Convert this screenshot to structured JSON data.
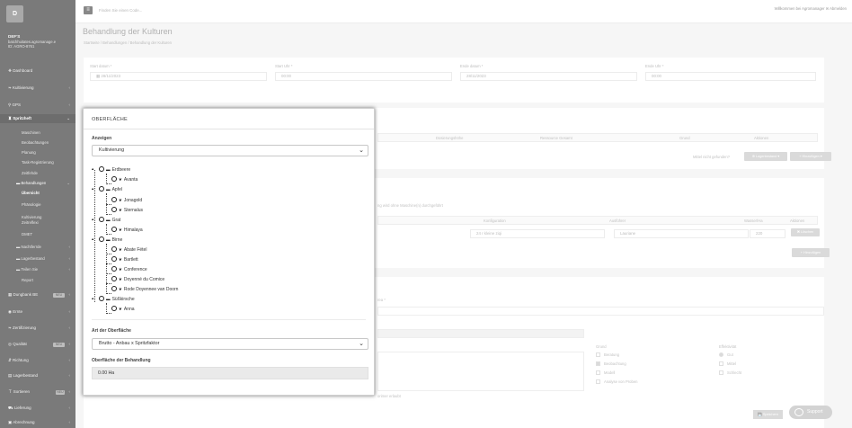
{
  "sidebar": {
    "logo": "D",
    "farm_name": "DEF'S",
    "farm_user": "batchhuitates.agromanage.e",
    "farm_id": "ID: AGRO-8761",
    "items": [
      {
        "label": "Dashboard"
      },
      {
        "label": "Kultivierung"
      },
      {
        "label": "GPS"
      },
      {
        "label": "Spritzheft"
      },
      {
        "label": "Maschinen"
      },
      {
        "label": "Beobachtungen"
      },
      {
        "label": "Planung"
      },
      {
        "label": "Task-Registrierung"
      },
      {
        "label": "Zeitfehde"
      },
      {
        "label": "Behandlungen"
      },
      {
        "label": "Übersicht"
      },
      {
        "label": "Phänologie"
      },
      {
        "label": "Kultivierung Zeitreflexi"
      },
      {
        "label": "DMET"
      },
      {
        "label": "Nachtferrde"
      },
      {
        "label": "Lagerbestand"
      },
      {
        "label": "Teilen Sie"
      },
      {
        "label": "Report"
      },
      {
        "label": "Dungbank BE"
      },
      {
        "label": "Ernte"
      },
      {
        "label": "Zertifizierung"
      },
      {
        "label": "Qualität"
      },
      {
        "label": "Richtung"
      },
      {
        "label": "Lagerbestand"
      },
      {
        "label": "Sortieren"
      },
      {
        "label": "Lieferung"
      },
      {
        "label": "Abrechnung"
      }
    ]
  },
  "topbar": {
    "search_placeholder": "Finden Sie einen Code...",
    "user": "Willkommen bei Agromanager  ✉ Abmelden"
  },
  "page": {
    "title": "Behandlung der Kulturen",
    "breadcrumb": "Startseite  /  Behandlungen  /  Behandlung der Kulturen"
  },
  "dates": {
    "start_date_label": "Start datum *",
    "start_date_value": "28/11/2023",
    "start_time_label": "Start Uhr *",
    "start_time_value": "00:00",
    "end_date_label": "Ende datum *",
    "end_date_value": "28/11/2023",
    "end_time_label": "Ende Uhr *",
    "end_time_value": "00:00"
  },
  "background": {
    "col_dose": "Dosierungshöhe",
    "col_resource": "Ressource Gesamt",
    "col_reason": "Grund",
    "col_actions": "Aktionen",
    "not_found": "Mittel nicht gefunden?",
    "btn_stock": "⊕ Lagerbestand ▾",
    "btn_add": "+ Hinzufügen ▾",
    "hint": "ng wird ohne Maschine(n) durchgeführt",
    "col_config": "Konfiguration",
    "col_operator": "Ausführer",
    "col_hours": "Wasser/Ha",
    "col_actions2": "Aktionen",
    "config_value": "24 r kleine ziqi",
    "operator_value": "Lauriane",
    "hours_value": "220",
    "btn_delete": "✖ Löschen",
    "btn_add2": "+ Hinzufügen",
    "area_label": "rea *",
    "reason_label": "Grund",
    "reason_opts": [
      "Beratung",
      "Beobachtung",
      "Modell",
      "Analyse von Proben"
    ],
    "effect_label": "Effektivität",
    "effect_opts": [
      "Gut",
      "Mittel",
      "Schlecht"
    ],
    "note": "orimer erlaubt",
    "save": "💾 Speichern"
  },
  "popup": {
    "title": "OBERFLÄCHE",
    "display_label": "Anzeigen",
    "display_value": "Kultivierung",
    "tree": [
      {
        "label": "Erdbeere"
      },
      {
        "label": "Avanta"
      },
      {
        "label": "Apfel"
      },
      {
        "label": "Jonagold"
      },
      {
        "label": "Sternalus"
      },
      {
        "label": "Grat"
      },
      {
        "label": "Himalaya"
      },
      {
        "label": "Birne"
      },
      {
        "label": "Abate Fétel"
      },
      {
        "label": "Bartlett"
      },
      {
        "label": "Conference"
      },
      {
        "label": "Doyenné du Comice"
      },
      {
        "label": "Rode Doyennee van Doorn"
      },
      {
        "label": "Süßkirsche"
      },
      {
        "label": "Anna"
      }
    ],
    "surface_type_label": "Art der Oberfläche",
    "surface_type_value": "Brutto - Anbau x Spritzfaktor",
    "treatment_area_label": "Oberfläche der Behandlung",
    "treatment_area_value": "0.00 Ha"
  },
  "support": {
    "label": "Support"
  }
}
